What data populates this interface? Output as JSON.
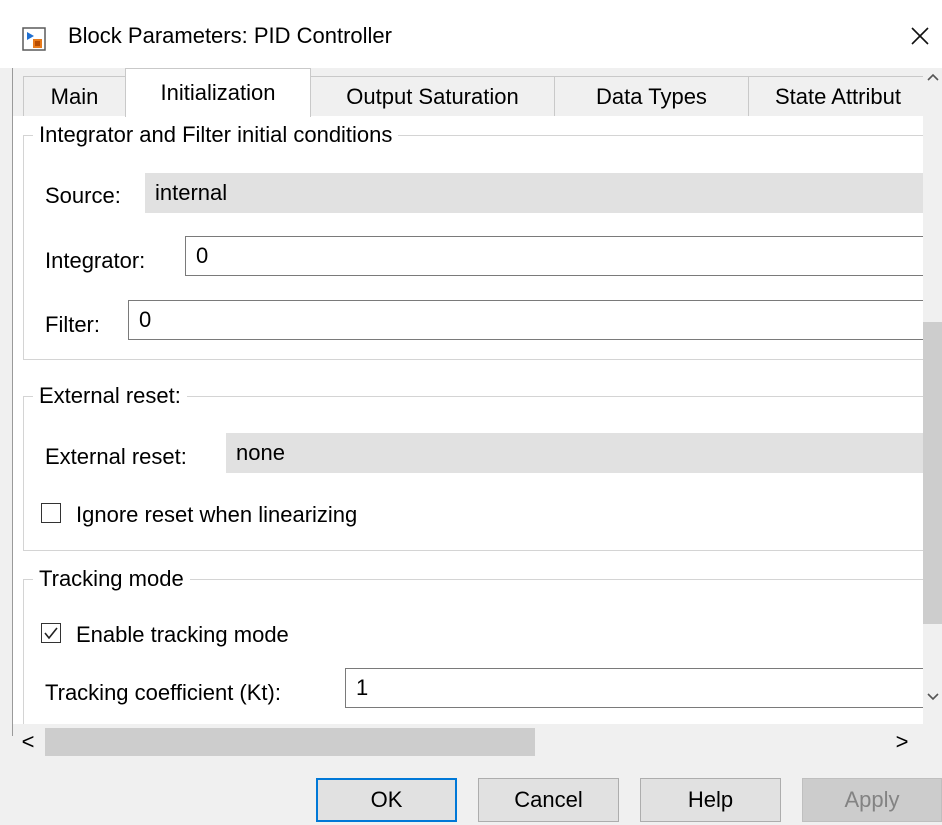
{
  "window": {
    "title": "Block Parameters: PID Controller",
    "close_glyph": "×"
  },
  "tabs": [
    {
      "label": "Main",
      "active": false
    },
    {
      "label": "Initialization",
      "active": true
    },
    {
      "label": "Output Saturation",
      "active": false
    },
    {
      "label": "Data Types",
      "active": false
    },
    {
      "label": "State Attribut",
      "active": false
    }
  ],
  "sections": {
    "initial_conditions": {
      "legend": "Integrator and Filter initial conditions",
      "source_label": "Source:",
      "source_value": "internal",
      "integrator_label": "Integrator:",
      "integrator_value": "0",
      "filter_label": "Filter:",
      "filter_value": "0"
    },
    "external_reset": {
      "legend": "External reset:",
      "reset_label": "External reset:",
      "reset_value": "none",
      "ignore_label": "Ignore reset when linearizing",
      "ignore_checked": false
    },
    "tracking": {
      "legend": "Tracking mode",
      "enable_label": "Enable tracking mode",
      "enable_checked": true,
      "coeff_label": "Tracking coefficient (Kt):",
      "coeff_value": "1"
    }
  },
  "scrollbars": {
    "left_arrow": "<",
    "right_arrow": ">"
  },
  "buttons": {
    "ok": "OK",
    "cancel": "Cancel",
    "help": "Help",
    "apply": "Apply"
  },
  "colors": {
    "default_button_border": "#0078d7",
    "readonly_field": "#e1e1e1",
    "disabled_text": "#838383"
  },
  "icons": {
    "app": "simulink-block-icon",
    "close": "close-icon",
    "check": "checkmark-icon"
  }
}
